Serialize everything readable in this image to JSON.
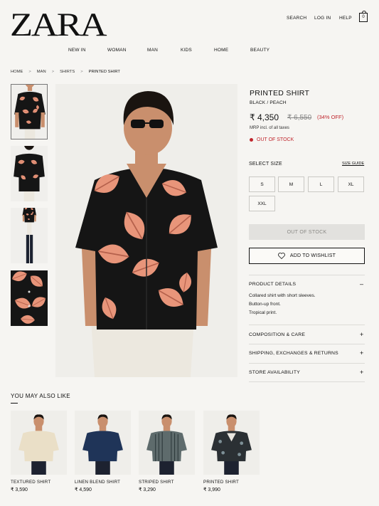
{
  "header": {
    "logo": "ZARA",
    "search": "SEARCH",
    "login": "LOG IN",
    "help": "HELP",
    "bag_count": "0"
  },
  "nav": [
    "NEW IN",
    "WOMAN",
    "MAN",
    "KIDS",
    "HOME",
    "BEAUTY"
  ],
  "breadcrumb": [
    "HOME",
    "MAN",
    "SHIRTS",
    "PRINTED SHIRT"
  ],
  "product": {
    "title": "PRINTED SHIRT",
    "color": "BLACK / PEACH",
    "price": "₹ 4,350",
    "mrp": "₹ 6,550",
    "discount": "(34% OFF)",
    "tax_note": "MRP incl. of all taxes",
    "stock_status": "OUT OF STOCK",
    "select_size": "SELECT SIZE",
    "size_guide": "SIZE GUIDE",
    "sizes": [
      "S",
      "M",
      "L",
      "XL",
      "XXL"
    ],
    "cta_out_of_stock": "OUT OF STOCK",
    "cta_wishlist": "ADD TO WISHLIST",
    "sections": {
      "details_title": "PRODUCT DETAILS",
      "details_lines": [
        "Collared shirt with short sleeves.",
        "Button-up front.",
        "Tropical print."
      ],
      "composition": "COMPOSITION & CARE",
      "shipping": "SHIPPING, EXCHANGES & RETURNS",
      "store": "STORE AVAILABILITY",
      "collapse_symbol": "–",
      "expand_symbol": "+"
    }
  },
  "related": {
    "title": "YOU MAY ALSO LIKE",
    "items": [
      {
        "name": "TEXTURED SHIRT",
        "price": "₹ 3,590"
      },
      {
        "name": "LINEN BLEND SHIRT",
        "price": "₹ 4,590"
      },
      {
        "name": "STRIPED SHIRT",
        "price": "₹ 3,290"
      },
      {
        "name": "PRINTED SHIRT",
        "price": "₹ 3,990"
      }
    ]
  },
  "colors": {
    "accent_red": "#c0262d",
    "shirt_black": "#151515",
    "print_peach": "#e8957a"
  },
  "icons": [
    "bag-icon",
    "heart-icon",
    "minus-icon",
    "plus-icon",
    "out-of-stock-dot"
  ]
}
